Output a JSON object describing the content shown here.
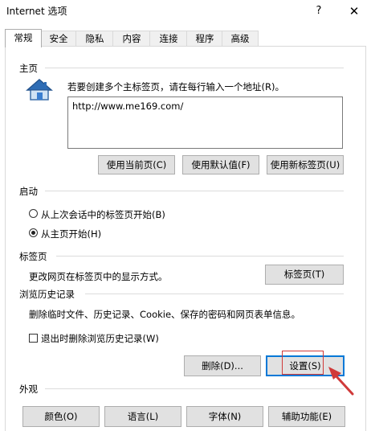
{
  "window": {
    "title": "Internet 选项",
    "help_glyph": "?",
    "close_glyph": "✕"
  },
  "tabs": [
    "常规",
    "安全",
    "隐私",
    "内容",
    "连接",
    "程序",
    "高级"
  ],
  "home_page": {
    "section_title": "主页",
    "description": "若要创建多个主标签页，请在每行输入一个地址(R)。",
    "url": "http://www.me169.com/",
    "buttons": {
      "use_current": "使用当前页(C)",
      "use_default": "使用默认值(F)",
      "use_new_tab": "使用新标签页(U)"
    }
  },
  "startup": {
    "section_title": "启动",
    "options": [
      {
        "label": "从上次会话中的标签页开始(B)",
        "selected": false
      },
      {
        "label": "从主页开始(H)",
        "selected": true
      }
    ]
  },
  "tabs_section": {
    "section_title": "标签页",
    "description": "更改网页在标签页中的显示方式。",
    "button": "标签页(T)"
  },
  "history": {
    "section_title": "浏览历史记录",
    "description": "删除临时文件、历史记录、Cookie、保存的密码和网页表单信息。",
    "checkbox_label": "退出时删除浏览历史记录(W)",
    "checkbox_checked": false,
    "delete_button": "删除(D)...",
    "settings_button": "设置(S)"
  },
  "appearance": {
    "section_title": "外观",
    "buttons": {
      "colors": "颜色(O)",
      "languages": "语言(L)",
      "fonts": "字体(N)",
      "accessibility": "辅助功能(E)"
    }
  },
  "colors": {
    "accent": "#0078d7",
    "annotation": "#d03a3a",
    "button_face": "#e1e1e1",
    "button_border": "#adadad"
  }
}
